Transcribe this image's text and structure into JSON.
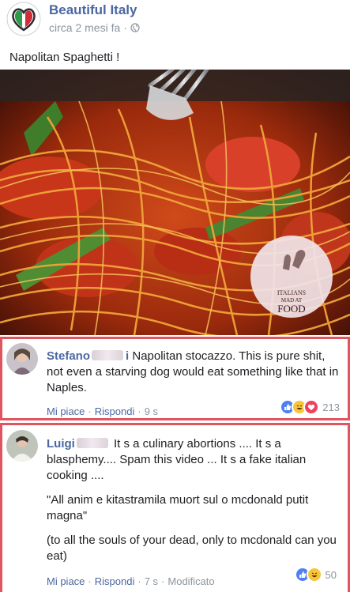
{
  "post": {
    "page_name": "Beautiful Italy",
    "time": "circa 2 mesi fa",
    "meta_sep": "·",
    "text": "Napolitan Spaghetti !"
  },
  "watermark": {
    "line1": "ITALIANS",
    "line2": "MAD AT",
    "line3": "FOOD"
  },
  "comments": [
    {
      "author": "Stefano",
      "author_suffix": "i",
      "text": "Napolitan stocazzo. This is pure shit, not even a starving dog would eat something like that in Naples.",
      "like": "Mi piace",
      "sep1": "·",
      "reply": "Rispondi",
      "sep2": "·",
      "time": "9 s",
      "reaction_count": "213",
      "reactions": [
        "like-reaction-icon",
        "haha-reaction-icon",
        "love-reaction-icon"
      ]
    },
    {
      "author": "Luigi",
      "text": "It s a culinary abortions .... It s a blasphemy.... Spam this video ... It s a fake italian cooking ....",
      "para2": "\"All anim e kitastramila muort sul o mcdonald putit magna\"",
      "para3": "(to all the souls of your dead, only to mcdonald can you eat)",
      "like": "Mi piace",
      "sep1": "·",
      "reply": "Rispondi",
      "sep2": "·",
      "time": "7 s",
      "sep3": "·",
      "edited": "Modificato",
      "reaction_count": "50",
      "reactions": [
        "like-reaction-icon",
        "haha-reaction-icon"
      ]
    }
  ],
  "colors": {
    "link": "#4b67a1",
    "meta": "#8d949e",
    "highlight_border": "#e0545f"
  }
}
